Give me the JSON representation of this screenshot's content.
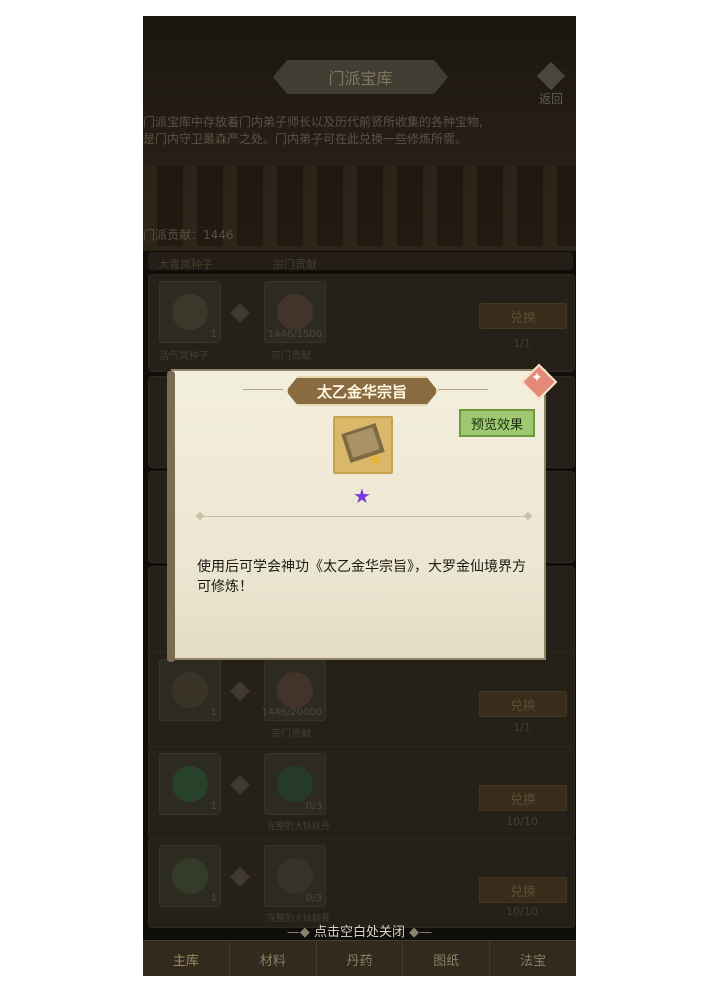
{
  "header": {
    "title": "门派宝库",
    "back_label": "返回"
  },
  "description": [
    "门派宝库中存放着门内弟子师长以及历代前贤所收集的各种宝物,",
    "是门内守卫最森严之处。门内弟子可在此兑换一些修炼所需。"
  ],
  "contribution": "门派贡献：1446",
  "list": {
    "top_header": [
      "大青岚种子",
      "宗门贡献"
    ],
    "rows": [
      {
        "item_label": "活气岚种子",
        "item_qty": "1",
        "cost_text": "1446/1500",
        "cost_label": "宗门贡献",
        "button": "兑换",
        "count": "1/1"
      },
      {
        "item_label": "",
        "item_qty": "1",
        "cost_text": "1446/20000",
        "cost_label": "宗门贡献",
        "button": "兑换",
        "count": "1/1"
      },
      {
        "item_label": "",
        "item_qty": "1",
        "cost_text": "0/3",
        "cost_label": "完整的大妖妖丹",
        "button": "兑换",
        "count": "10/10"
      },
      {
        "item_label": "",
        "item_qty": "1",
        "cost_text": "0/3",
        "cost_label": "完整的大妖骸骨",
        "button": "兑换",
        "count": "10/10"
      }
    ]
  },
  "close_hint": "点击空白处关闭",
  "tabs": [
    "主库",
    "材料",
    "丹药",
    "图纸",
    "法宝"
  ],
  "modal": {
    "title": "太乙金华宗旨",
    "preview_button": "预览效果",
    "star_glyph": "★",
    "description": "使用后可学会神功《太乙金华宗旨》，大罗金仙境界方可修炼！"
  },
  "colors": {
    "accent": "#8a6a3f",
    "preview": "#9dc770",
    "star": "#7b3ad8"
  }
}
